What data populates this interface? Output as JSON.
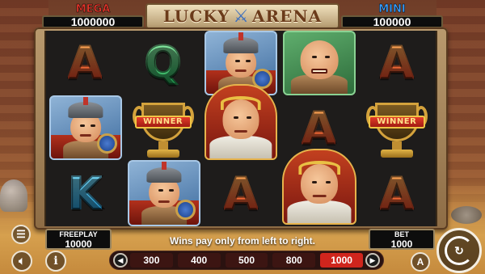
{
  "game": {
    "logo": {
      "word1": "LUCKY",
      "icon": "crossed-swords-icon",
      "word2": "ARENA"
    },
    "jackpots": {
      "mega": {
        "label": "MEGA",
        "value": "1000000",
        "color": "#e0352a"
      },
      "mini": {
        "label": "MINI",
        "value": "100000",
        "color": "#3aa0ff"
      }
    },
    "reels": [
      [
        "A",
        "gladiator-blue",
        "K"
      ],
      [
        "Q",
        "trophy-winner",
        "gladiator-blue"
      ],
      [
        "gladiator-blue",
        "caesar",
        "A"
      ],
      [
        "brute-green",
        "A",
        "caesar"
      ],
      [
        "A",
        "trophy-winner",
        "A"
      ]
    ],
    "winner_text": "WINNER",
    "freeplay": {
      "label": "FREEPLAY",
      "value": "10000"
    },
    "bet": {
      "label": "BET",
      "value": "1000"
    },
    "message": "Wins pay only from left to right.",
    "bet_options": [
      "300",
      "400",
      "500",
      "800",
      "1000"
    ],
    "selected_bet_index": 4,
    "buttons": {
      "menu": "menu-icon",
      "sound": "speaker-icon",
      "info": "info-icon",
      "auto": "auto-play-icon",
      "spin": "spin-icon"
    },
    "info_glyph": "i",
    "auto_glyph": "A",
    "colors": {
      "active_bet": "#d0251d",
      "letter_A": "#ef5a2a",
      "letter_Q": "#22a454",
      "letter_K": "#1a8fd0"
    }
  }
}
